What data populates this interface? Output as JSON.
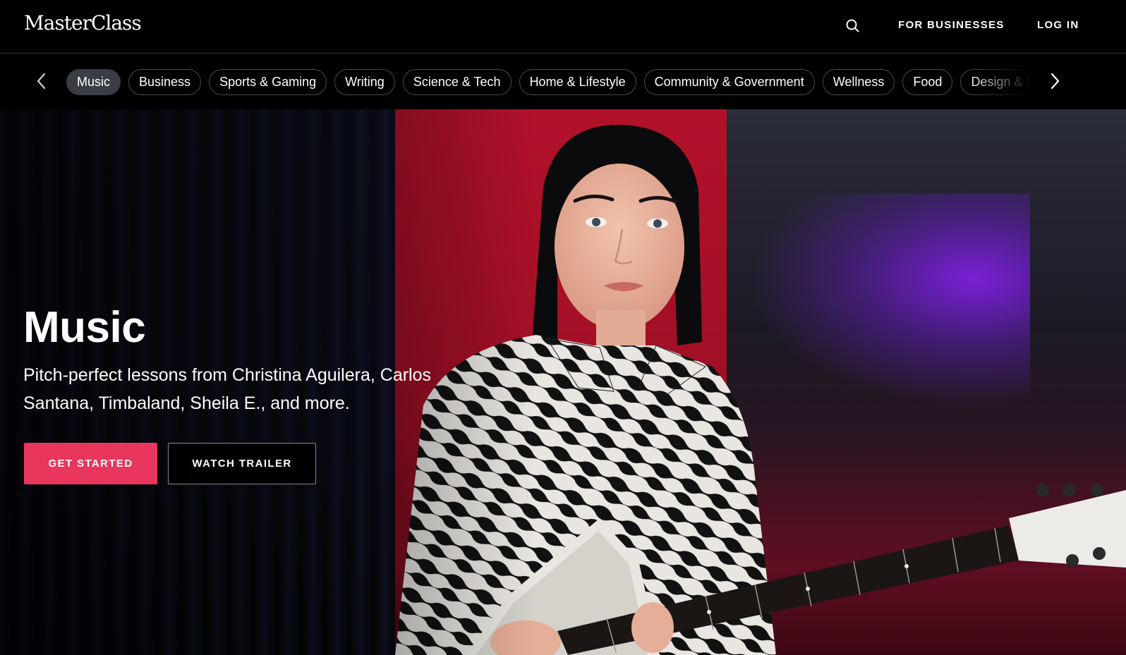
{
  "header": {
    "logo": "MasterClass",
    "for_businesses": "FOR BUSINESSES",
    "login": "LOG IN"
  },
  "categories": [
    {
      "label": "Music",
      "active": true
    },
    {
      "label": "Business"
    },
    {
      "label": "Sports & Gaming"
    },
    {
      "label": "Writing"
    },
    {
      "label": "Science & Tech"
    },
    {
      "label": "Home & Lifestyle"
    },
    {
      "label": "Community & Government"
    },
    {
      "label": "Wellness"
    },
    {
      "label": "Food"
    },
    {
      "label": "Design & Style"
    }
  ],
  "hero": {
    "title": "Music",
    "description": "Pitch-perfect lessons from Christina Aguilera, Carlos Santana, Timbaland, Sheila E., and more.",
    "get_started": "GET STARTED",
    "watch_trailer": "WATCH TRAILER"
  },
  "colors": {
    "accent": "#e8365d",
    "background": "#000000",
    "pill_active": "#3a3d44"
  },
  "icons": [
    "search-icon",
    "chevron-left-icon",
    "chevron-right-icon"
  ]
}
